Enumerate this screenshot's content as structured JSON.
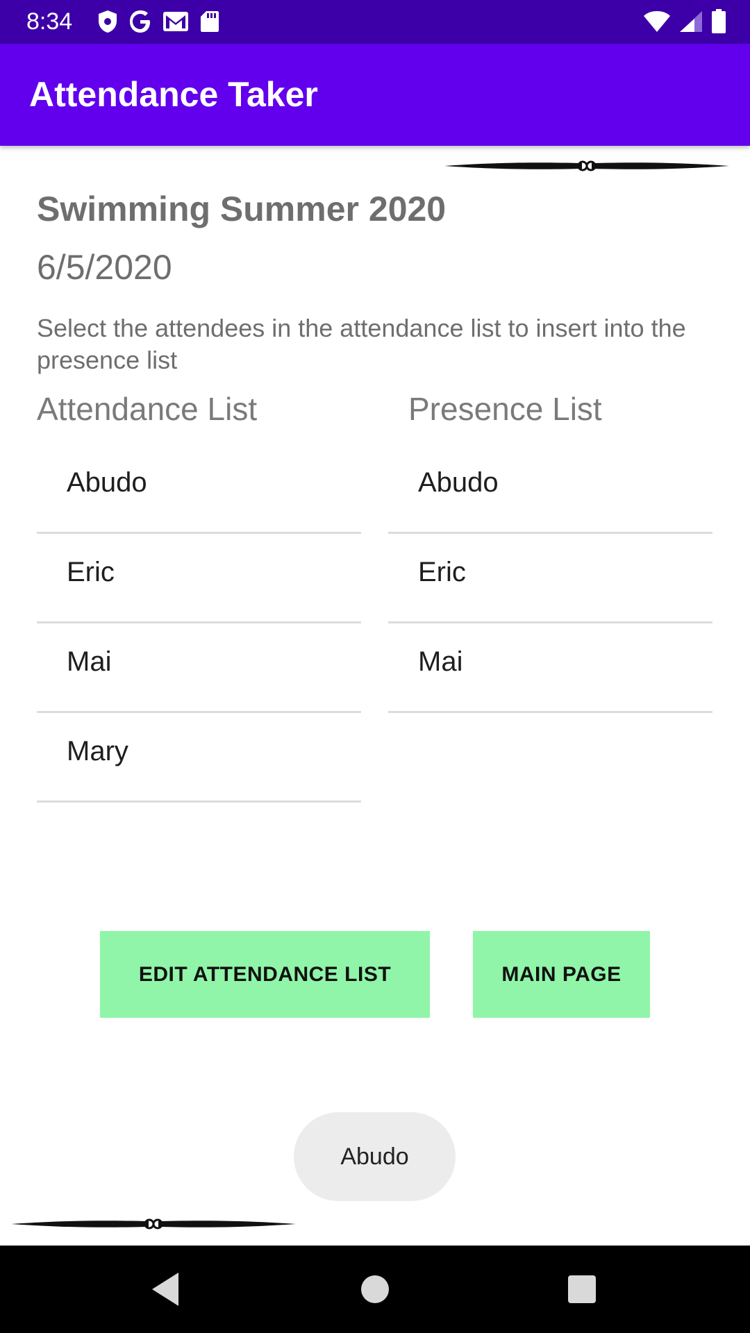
{
  "status_bar": {
    "time": "8:34",
    "left_icons": [
      "shield-icon",
      "google-icon",
      "gmail-icon",
      "sd-card-icon"
    ],
    "right_icons": [
      "wifi-icon",
      "signal-icon",
      "battery-icon"
    ]
  },
  "app_bar": {
    "title": "Attendance Taker",
    "color": "#6200ee"
  },
  "course": {
    "title": "Swimming Summer 2020",
    "date": "6/5/2020"
  },
  "instructions": "Select the attendees in the attendance list to insert into the presence list",
  "attendance_list": {
    "header": "Attendance List",
    "items": [
      {
        "name": "Abudo"
      },
      {
        "name": "Eric"
      },
      {
        "name": "Mai"
      },
      {
        "name": "Mary"
      }
    ]
  },
  "presence_list": {
    "header": "Presence List",
    "items": [
      {
        "name": "Abudo"
      },
      {
        "name": "Eric"
      },
      {
        "name": "Mai"
      }
    ]
  },
  "buttons": {
    "edit_label": "EDIT ATTENDANCE LIST",
    "main_label": "MAIN PAGE",
    "color": "#90f5a8"
  },
  "toast": {
    "text": "Abudo"
  },
  "nav_bar": {
    "icons": [
      "back-icon",
      "home-icon",
      "recents-icon"
    ]
  }
}
